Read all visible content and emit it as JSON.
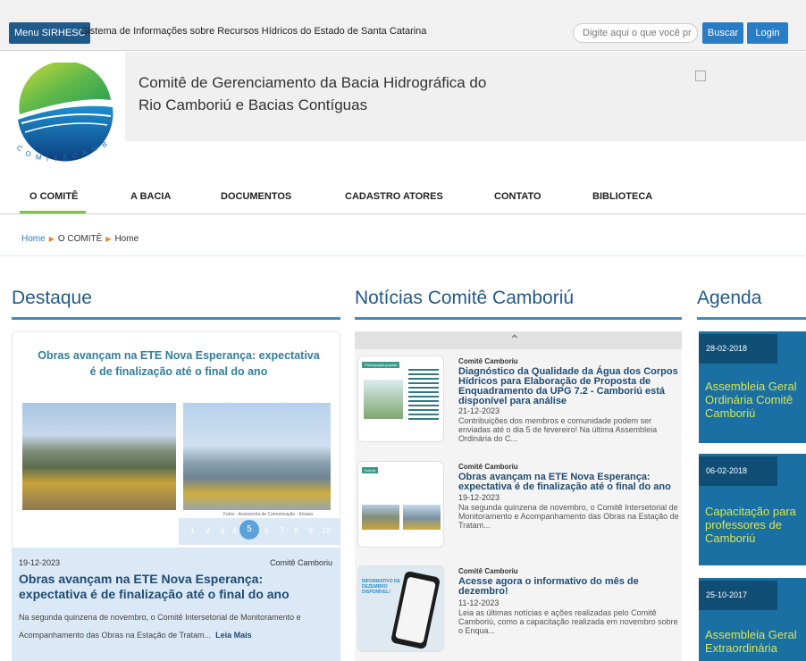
{
  "topbar": {
    "menu_label": "Menu SIRHESC",
    "system_title": "Sistema de Informações sobre Recursos Hídricos do Estado de Santa Catarina",
    "search_placeholder": "Digite aqui o que você pr",
    "search_button": "Buscar",
    "login_button": "Login"
  },
  "header": {
    "title_line1": "Comitê de Gerenciamento da Bacia Hidrográfica do",
    "title_line2": "Rio Camboriú e Bacias Contíguas",
    "logo_text": "COMITÊ CAMBORIÚ"
  },
  "nav": {
    "items": [
      {
        "label": "O COMITÊ"
      },
      {
        "label": "A BACIA"
      },
      {
        "label": "DOCUMENTOS"
      },
      {
        "label": "CADASTRO ATORES"
      },
      {
        "label": "CONTATO"
      },
      {
        "label": "BIBLIOTECA"
      }
    ]
  },
  "breadcrumb": {
    "home": "Home",
    "section": "O COMITÊ",
    "current": "Home"
  },
  "destaque": {
    "section_title": "Destaque",
    "image_heading": "Obras avançam na ETE Nova Esperança: expectativa é de finalização até o final do ano",
    "photo_credit": "Fotos - Assessoria de Comunicação - Emasa",
    "pages": [
      "1",
      "2",
      "3",
      "4",
      "5",
      "6",
      "7",
      "8",
      "9",
      "10"
    ],
    "active_page": "5",
    "date": "19-12-2023",
    "category": "Comitê Camboriu",
    "title": "Obras avançam na ETE Nova Esperança: expectativa é de finalização até o final do ano",
    "body": "Na segunda quinzena de novembro, o Comitê Intersetorial de Monitoramento e Acompanhamento das Obras na Estação de Tratam...",
    "read_more": "Leia Mais"
  },
  "noticias": {
    "section_title": "Notícias Comitê Camboriú",
    "items": [
      {
        "category": "Comitê Camboriu",
        "title": "Diagnóstico da Qualidade da Água dos Corpos Hídricos para Elaboração de Proposta de Enquadramento da UPG 7.2 - Camboriú está disponível para análise",
        "date": "21-12-2023",
        "body": "Contribuições dos membros e comunidade podem ser enviadas até o dia 5 de fevereiro! Na última Assembleia Ordinária do C...",
        "thumb_tag": "Participação popular"
      },
      {
        "category": "Comitê Camboriu",
        "title": "Obras avançam na ETE Nova Esperança: expectativa é de finalização até o final do ano",
        "date": "19-12-2023",
        "body": "Na segunda quinzena de novembro, o Comitê Intersetorial de Monitoramento e Acompanhamento das Obras na Estação de Tratam...",
        "thumb_tag": "Notícia"
      },
      {
        "category": "Comitê Camboriu",
        "title": "Acesse agora o informativo do mês de dezembro!",
        "date": "11-12-2023",
        "body": "Leia as últimas notícias e ações realizadas pelo Comitê Camboriú, como a capacitação realizada em novembro sobre o Enqua...",
        "thumb_tag": "INFORMATIVO DE DEZEMBRO DISPONÍVEL!"
      }
    ]
  },
  "agenda": {
    "section_title": "Agenda",
    "items": [
      {
        "date": "28-02-2018",
        "title": "Assembleia Geral Ordinária Comitê Camboriú"
      },
      {
        "date": "06-02-2018",
        "title": "Capacitação para professores de Camboriú"
      },
      {
        "date": "25-10-2017",
        "title": "Assembleia Geral Extraordinária"
      }
    ]
  },
  "colors": {
    "primary_dark": "#1f5a8a",
    "button_blue": "#2a7cc4",
    "nav_accent": "#7ec04a",
    "agenda_bg": "#1a6fa3",
    "agenda_title": "#d6e84a"
  }
}
